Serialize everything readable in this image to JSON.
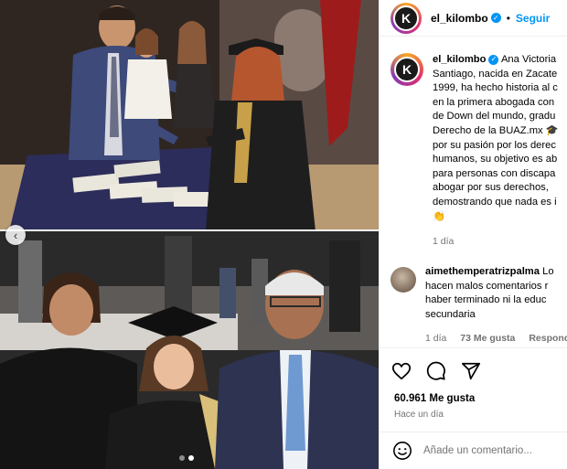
{
  "post": {
    "username": "el_kilombo",
    "avatar_letter": "K",
    "follow_label": "Seguir",
    "separator": "•",
    "caption_lines": [
      "Ana Victoria",
      "Santiago, nacida en Zacate",
      "1999, ha hecho historia al c",
      "en la primera abogada con",
      "de Down del mundo, gradu",
      "Derecho de la BUAZ.mx 🎓",
      "por su pasión por los derec",
      "humanos, su objetivo es ab",
      "para personas con discapa",
      "abogar por sus derechos,",
      "demostrando que nada es i",
      "👏"
    ],
    "caption_time": "1 día"
  },
  "comment": {
    "username": "aimethemperatrizpalma",
    "lines": [
      "Lo",
      "hacen malos comentarios r",
      "haber terminado ni la educ",
      "secundaria"
    ],
    "time": "1 día",
    "likes": "73 Me gusta",
    "reply": "Responder"
  },
  "stats": {
    "likes": "60.961 Me gusta",
    "when": "Hace un día"
  },
  "composer": {
    "placeholder": "Añade un comentario..."
  },
  "icons": {
    "verified": "verified-badge-icon",
    "heart": "heart-icon",
    "comment": "comment-bubble-icon",
    "share": "paper-plane-icon",
    "emoji": "smiley-icon",
    "prev": "chevron-left-icon"
  },
  "colors": {
    "accent": "#0095f6",
    "muted": "#737373",
    "divider": "#efefef"
  },
  "carousel": {
    "total_slides": 2,
    "active_slide": 2
  }
}
